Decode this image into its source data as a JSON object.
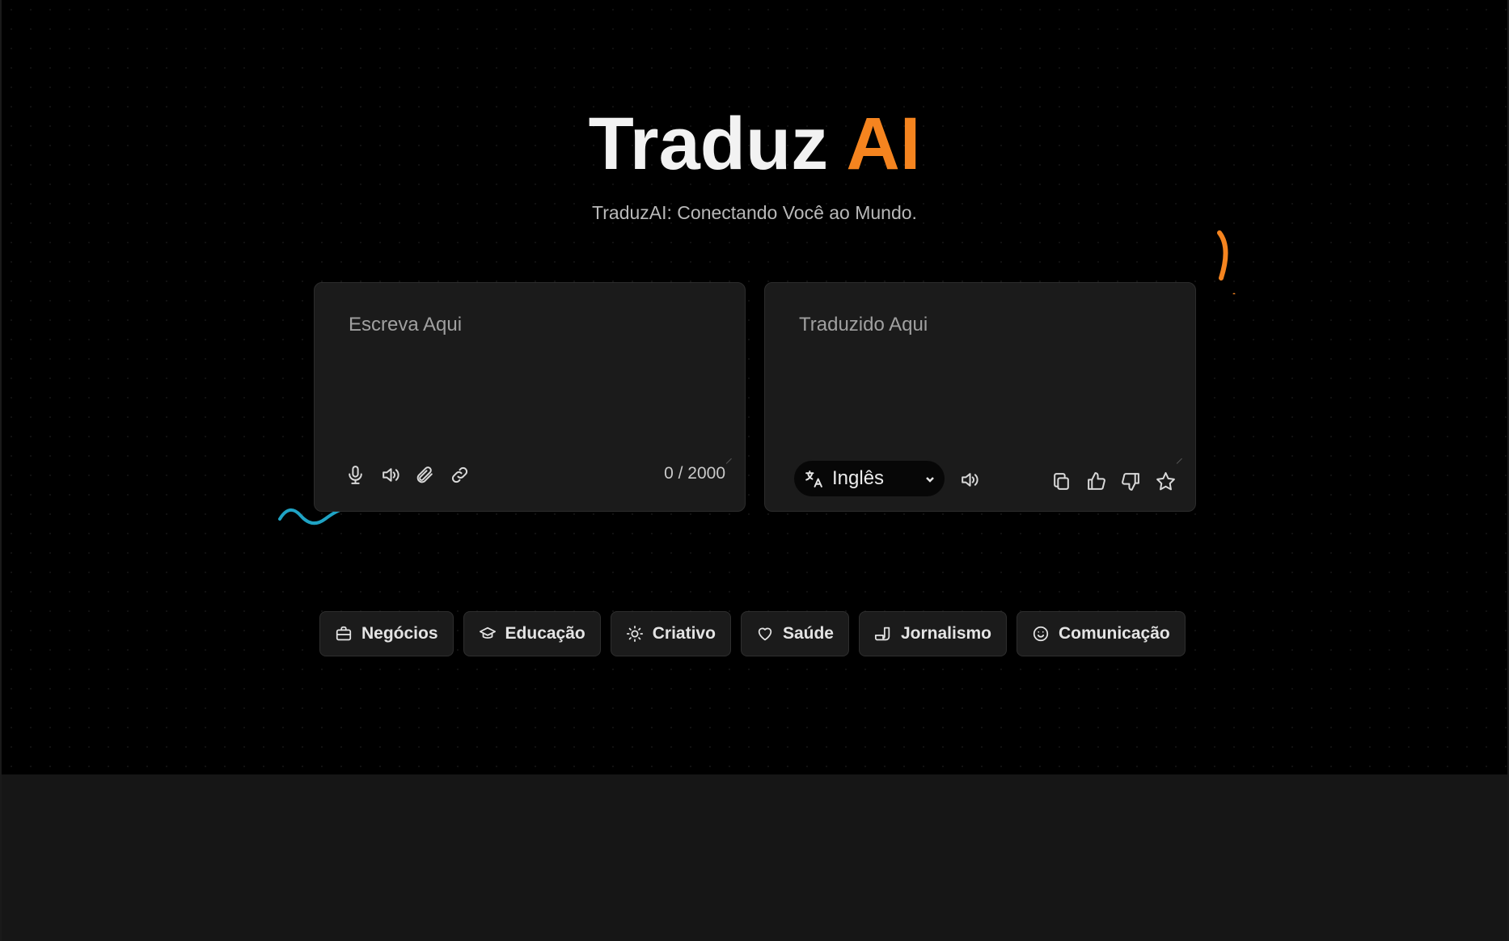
{
  "header": {
    "title_main": "Traduz",
    "title_accent": "AI",
    "subtitle": "TraduzAI: Conectando Você ao Mundo."
  },
  "source_panel": {
    "placeholder": "Escreva Aqui",
    "char_count": "0 / 2000",
    "tools": [
      "microphone-icon",
      "speaker-icon",
      "paperclip-icon",
      "link-icon"
    ]
  },
  "target_panel": {
    "placeholder": "Traduzido Aqui",
    "language": "Inglês",
    "tools": [
      "speaker-icon",
      "copy-icon",
      "thumbs-up-icon",
      "thumbs-down-icon",
      "star-icon"
    ]
  },
  "categories": [
    {
      "label": "Negócios",
      "icon": "briefcase-icon"
    },
    {
      "label": "Educação",
      "icon": "graduation-cap-icon"
    },
    {
      "label": "Criativo",
      "icon": "lightbulb-icon"
    },
    {
      "label": "Saúde",
      "icon": "heart-icon"
    },
    {
      "label": "Jornalismo",
      "icon": "newspaper-icon"
    },
    {
      "label": "Comunicação",
      "icon": "smile-icon"
    }
  ],
  "colors": {
    "accent": "#f5841f",
    "wave": "#1fa3c4",
    "background": "#000000"
  }
}
